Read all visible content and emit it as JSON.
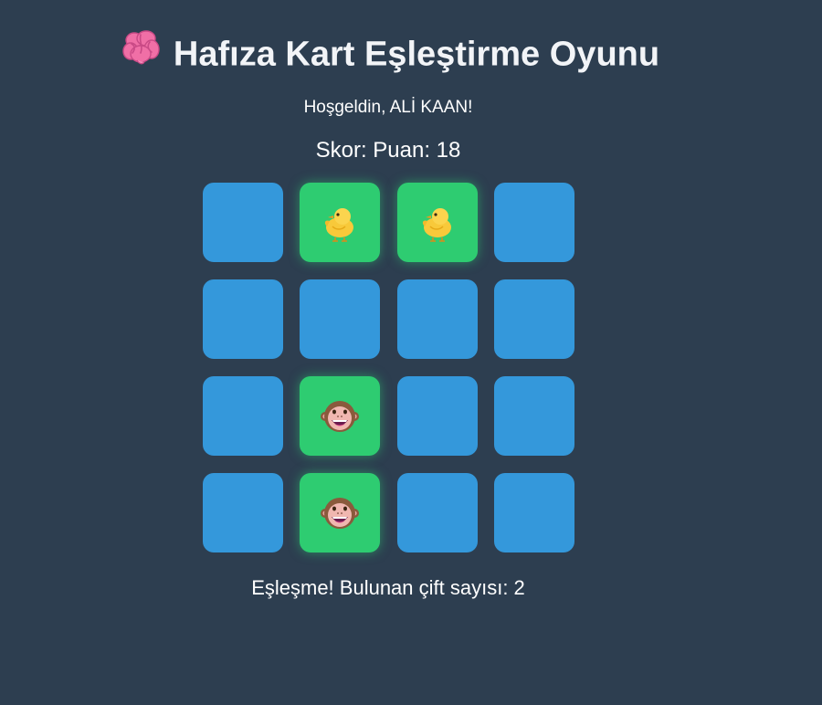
{
  "header": {
    "icon": "brain-icon",
    "title": "Hafıza Kart Eşleştirme Oyunu"
  },
  "welcome_text": "Hoşgeldin, ALİ KAAN!",
  "score_text": "Skor: Puan: 18",
  "status_text": "Eşleşme! Bulunan çift sayısı: 2",
  "colors": {
    "background": "#2d3e50",
    "card_hidden": "#3498db",
    "card_matched": "#2ecc71"
  },
  "board": {
    "rows": 4,
    "cols": 4,
    "cards": [
      {
        "state": "hidden",
        "icon": ""
      },
      {
        "state": "matched",
        "icon": "chick-icon"
      },
      {
        "state": "matched",
        "icon": "chick-icon"
      },
      {
        "state": "hidden",
        "icon": ""
      },
      {
        "state": "hidden",
        "icon": ""
      },
      {
        "state": "hidden",
        "icon": ""
      },
      {
        "state": "hidden",
        "icon": ""
      },
      {
        "state": "hidden",
        "icon": ""
      },
      {
        "state": "hidden",
        "icon": ""
      },
      {
        "state": "matched",
        "icon": "monkey-face-icon"
      },
      {
        "state": "hidden",
        "icon": ""
      },
      {
        "state": "hidden",
        "icon": ""
      },
      {
        "state": "hidden",
        "icon": ""
      },
      {
        "state": "matched",
        "icon": "monkey-face-icon"
      },
      {
        "state": "hidden",
        "icon": ""
      },
      {
        "state": "hidden",
        "icon": ""
      }
    ]
  }
}
